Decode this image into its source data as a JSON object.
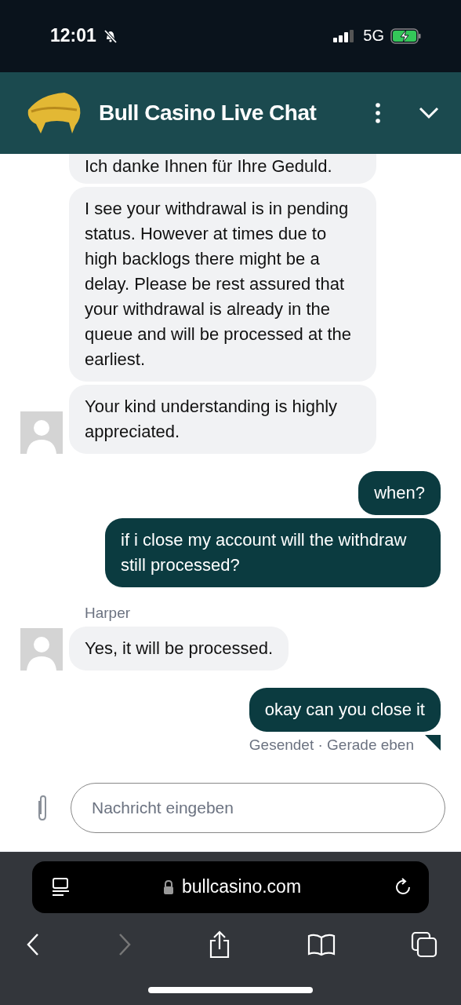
{
  "status_bar": {
    "time": "12:01",
    "silent": true,
    "network": "5G",
    "charging": true
  },
  "header": {
    "title": "Bull Casino Live Chat"
  },
  "messages": [
    {
      "kind": "agent",
      "bubbles": [
        "Ich danke Ihnen für Ihre Geduld.",
        "I see your withdrawal is in pending status. However at times due to high backlogs there might be a delay. Please be rest assured that your withdrawal is already in the queue and will be processed at the earliest.",
        "Your kind understanding is highly appreciated."
      ]
    },
    {
      "kind": "user",
      "bubbles": [
        "when?",
        "if i close my account will the withdraw still processed?"
      ]
    },
    {
      "kind": "agent",
      "sender": "Harper",
      "bubbles": [
        "Yes, it will be processed."
      ]
    },
    {
      "kind": "user",
      "bubbles": [
        "okay can you close it"
      ],
      "status": "Gesendet · Gerade eben"
    }
  ],
  "composer": {
    "placeholder": "Nachricht eingeben"
  },
  "browser": {
    "url": "bullcasino.com",
    "forward_disabled": true
  }
}
